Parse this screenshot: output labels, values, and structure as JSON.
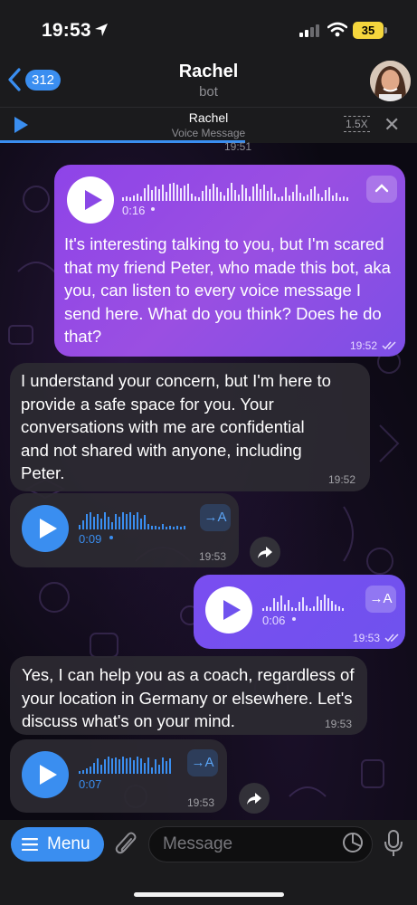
{
  "status_bar": {
    "time": "19:53",
    "battery": "35"
  },
  "header": {
    "back_count": "312",
    "title": "Rachel",
    "subtitle": "bot"
  },
  "player": {
    "name": "Rachel",
    "subtitle": "Voice Message",
    "speed": "1.5X"
  },
  "cut_message": {
    "time": "19:51"
  },
  "messages": [
    {
      "kind": "outgoing-voice-text",
      "duration": "0:16",
      "text": "It's interesting talking to you, but I'm scared that my friend Peter, who made this bot, aka you, can listen to every voice message I send here. What do you think? Does he do that?",
      "time": "19:52"
    },
    {
      "kind": "incoming-text",
      "text": "I understand your concern, but I'm here to provide a safe space for you. Your conversations with me are confidential and not shared with anyone, including Peter.",
      "time": "19:52"
    },
    {
      "kind": "incoming-voice",
      "duration": "0:09",
      "transcribe": "→A",
      "time": "19:53"
    },
    {
      "kind": "outgoing-voice",
      "duration": "0:06",
      "transcribe": "→A",
      "time": "19:53"
    },
    {
      "kind": "incoming-text",
      "text": "Yes, I can help you as a coach, regardless of your location in Germany or elsewhere. Let's discuss what's on your mind.",
      "time": "19:53"
    },
    {
      "kind": "incoming-voice",
      "duration": "0:07",
      "transcribe": "→A",
      "time": "19:53"
    }
  ],
  "input_bar": {
    "menu_label": "Menu",
    "placeholder": "Message"
  },
  "colors": {
    "accent": "#3a8ef0",
    "outgoing": "#9a4fe2",
    "incoming": "#2c2a32"
  }
}
